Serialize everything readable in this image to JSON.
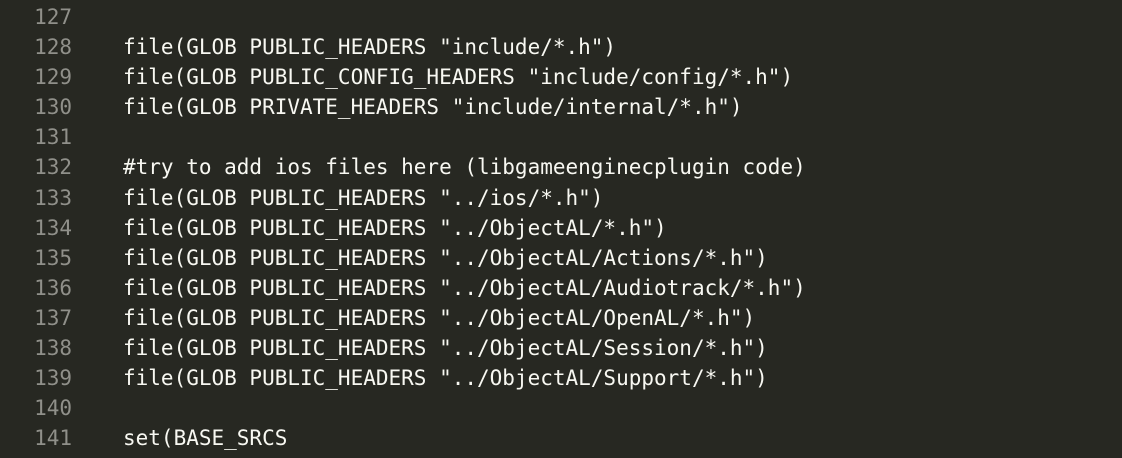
{
  "editor": {
    "lines": [
      {
        "number": "127",
        "code": ""
      },
      {
        "number": "128",
        "code": "file(GLOB PUBLIC_HEADERS \"include/*.h\")"
      },
      {
        "number": "129",
        "code": "file(GLOB PUBLIC_CONFIG_HEADERS \"include/config/*.h\")"
      },
      {
        "number": "130",
        "code": "file(GLOB PRIVATE_HEADERS \"include/internal/*.h\")"
      },
      {
        "number": "131",
        "code": ""
      },
      {
        "number": "132",
        "code": "#try to add ios files here (libgameenginecplugin code)"
      },
      {
        "number": "133",
        "code": "file(GLOB PUBLIC_HEADERS \"../ios/*.h\")"
      },
      {
        "number": "134",
        "code": "file(GLOB PUBLIC_HEADERS \"../ObjectAL/*.h\")"
      },
      {
        "number": "135",
        "code": "file(GLOB PUBLIC_HEADERS \"../ObjectAL/Actions/*.h\")"
      },
      {
        "number": "136",
        "code": "file(GLOB PUBLIC_HEADERS \"../ObjectAL/Audiotrack/*.h\")"
      },
      {
        "number": "137",
        "code": "file(GLOB PUBLIC_HEADERS \"../ObjectAL/OpenAL/*.h\")"
      },
      {
        "number": "138",
        "code": "file(GLOB PUBLIC_HEADERS \"../ObjectAL/Session/*.h\")"
      },
      {
        "number": "139",
        "code": "file(GLOB PUBLIC_HEADERS \"../ObjectAL/Support/*.h\")"
      },
      {
        "number": "140",
        "code": ""
      },
      {
        "number": "141",
        "code": "set(BASE_SRCS"
      }
    ]
  },
  "colors": {
    "background": "#272822",
    "text": "#f8f8f2",
    "line_number": "#90908a"
  }
}
